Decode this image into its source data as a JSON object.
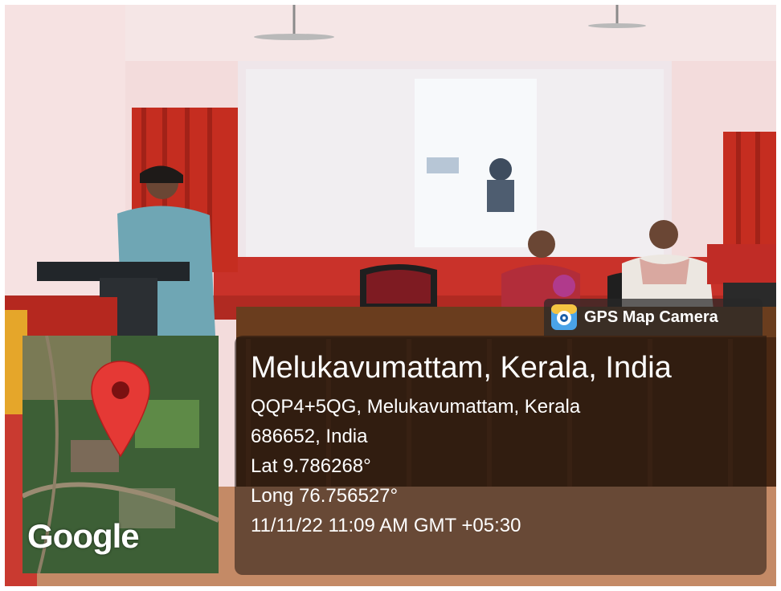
{
  "badge": {
    "label": "GPS Map Camera",
    "icon": "gps-map-camera-icon"
  },
  "map": {
    "logo": "Google",
    "pin_icon": "map-pin-icon",
    "pin_color": "#e53935"
  },
  "location": {
    "title": "Melukavumattam, Kerala, India",
    "address_line1": "QQP4+5QG, Melukavumattam, Kerala",
    "address_line2": "686652, India",
    "lat": "Lat 9.786268°",
    "long": "Long 76.756527°",
    "datetime": "11/11/22 11:09 AM GMT +05:30"
  }
}
